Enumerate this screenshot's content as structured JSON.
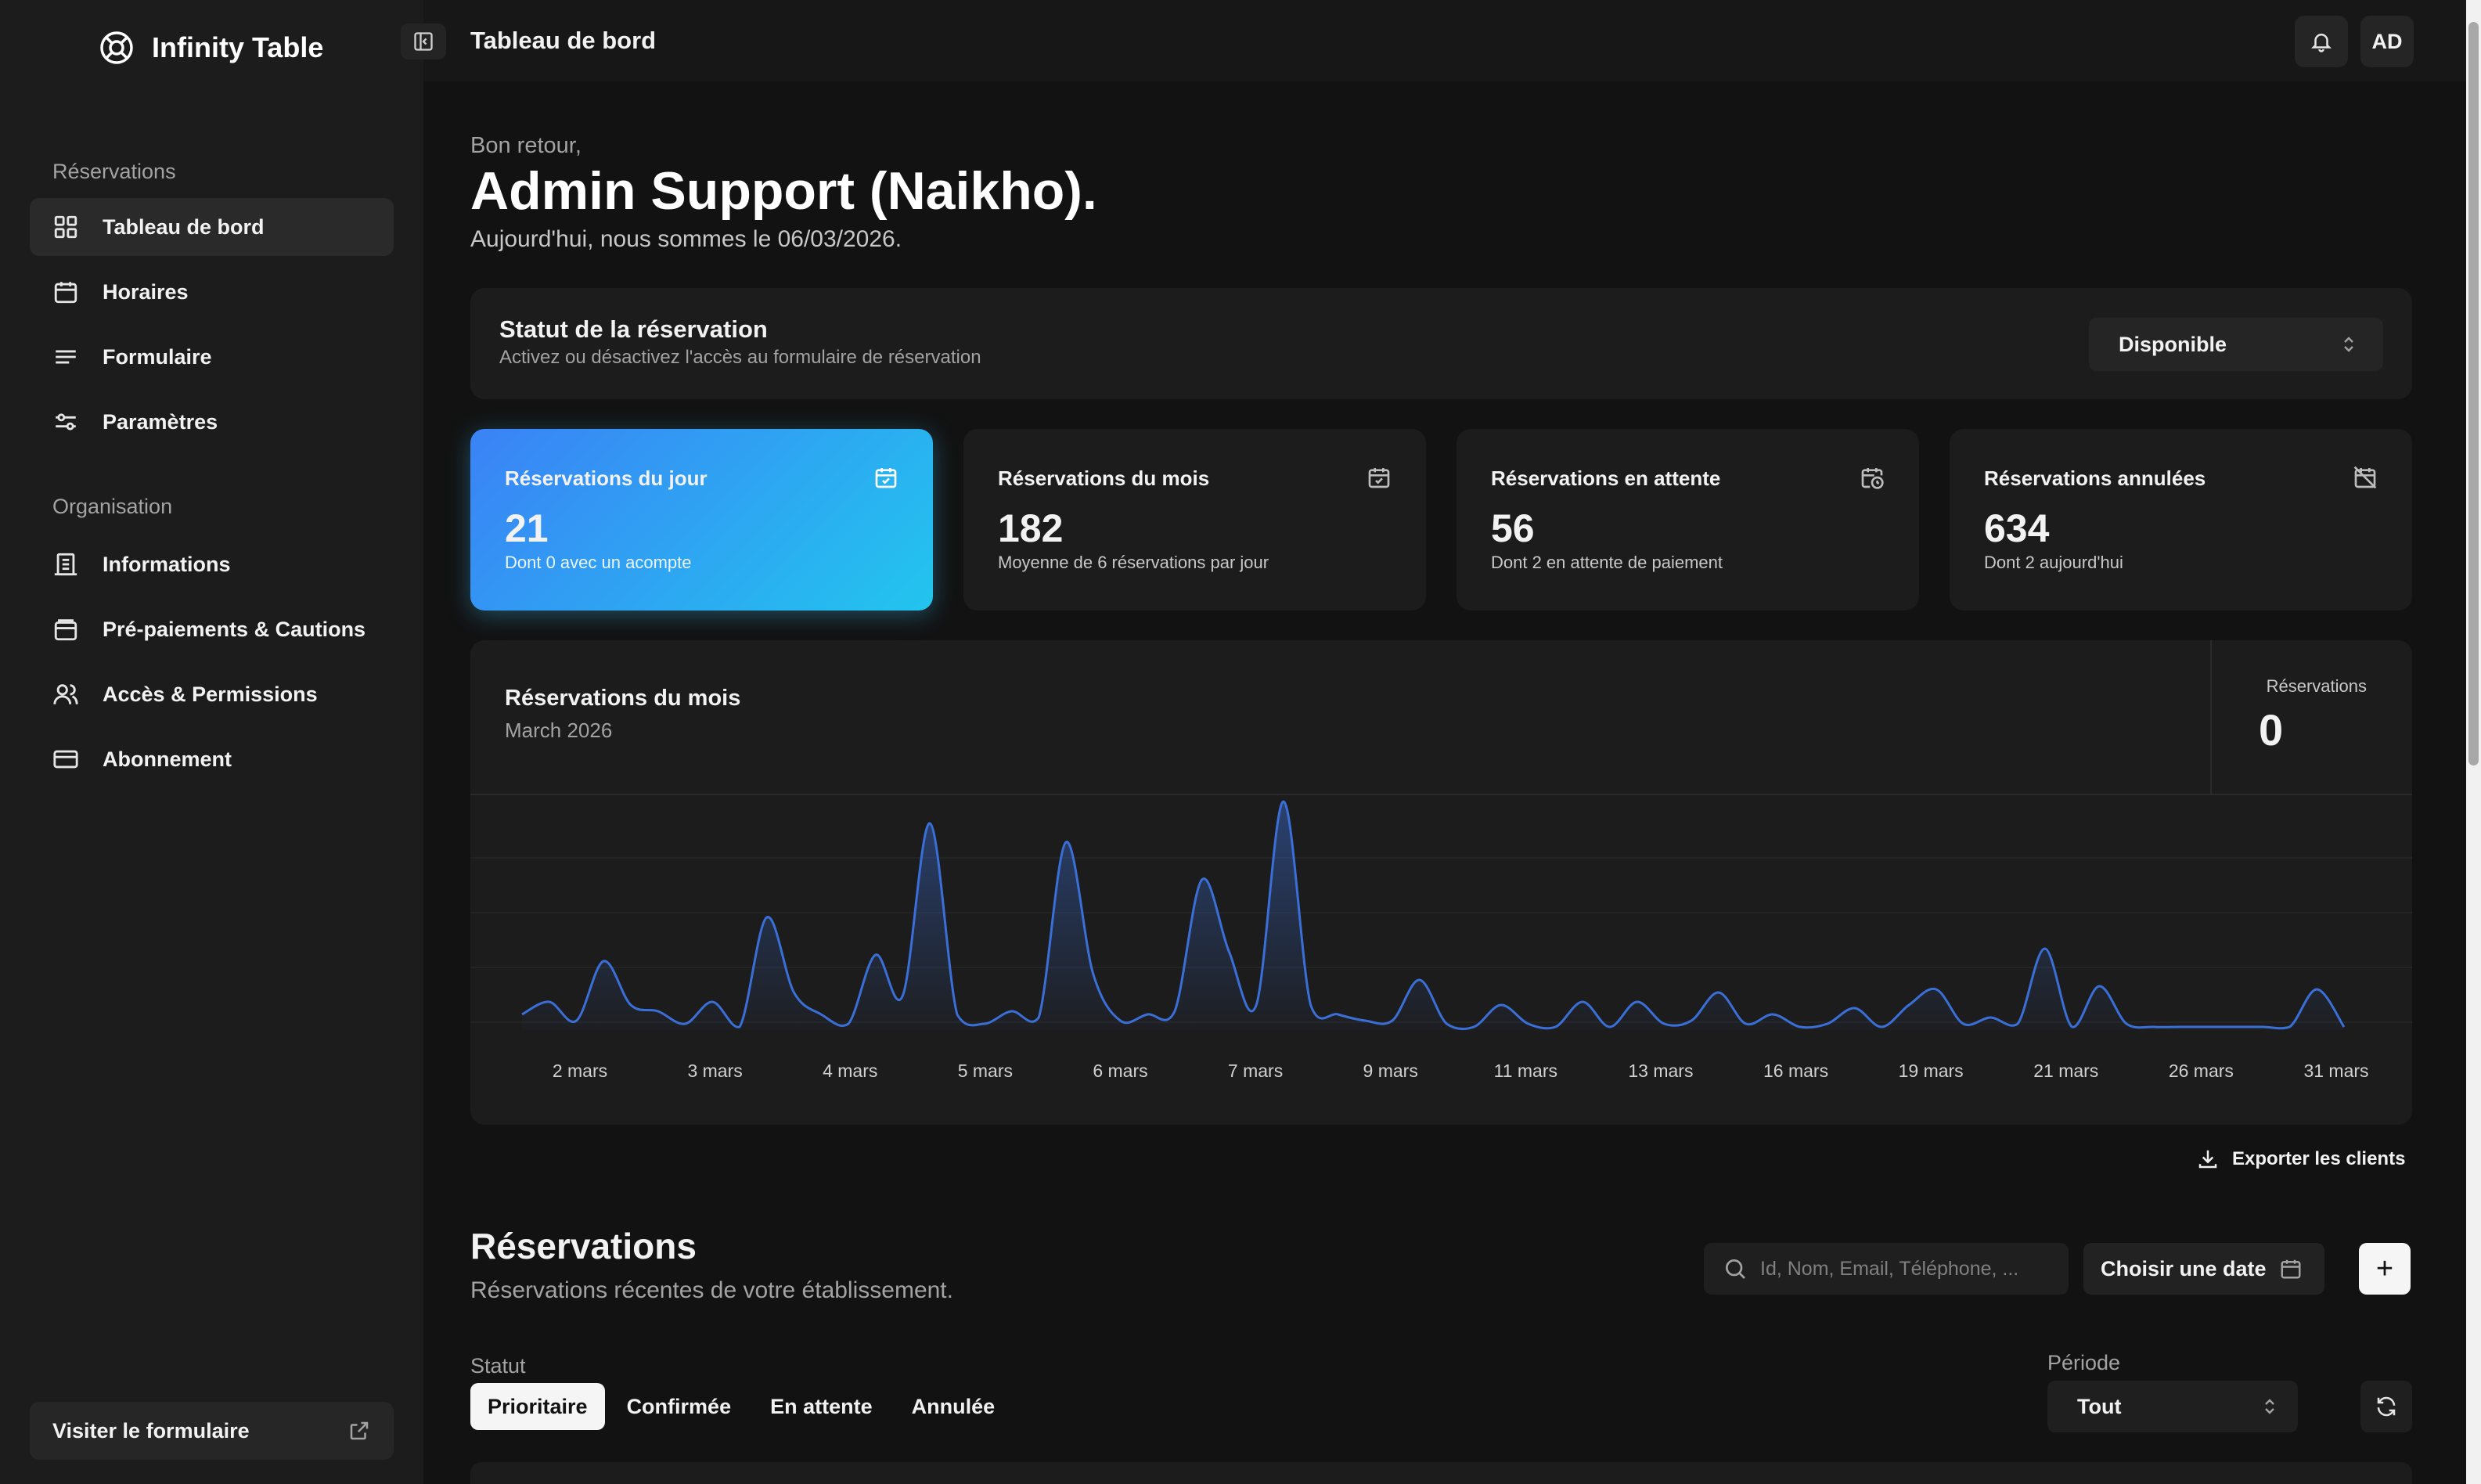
{
  "brand": {
    "name": "Infinity Table"
  },
  "sidebar": {
    "groups": [
      {
        "label": "Réservations",
        "items": [
          {
            "label": "Tableau de bord",
            "icon": "grid-icon"
          },
          {
            "label": "Horaires",
            "icon": "calendar-icon"
          },
          {
            "label": "Formulaire",
            "icon": "text-lines-icon"
          },
          {
            "label": "Paramètres",
            "icon": "sliders-icon"
          }
        ]
      },
      {
        "label": "Organisation",
        "items": [
          {
            "label": "Informations",
            "icon": "building-icon"
          },
          {
            "label": "Pré-paiements & Cautions",
            "icon": "wallet-icon"
          },
          {
            "label": "Accès & Permissions",
            "icon": "users-icon"
          },
          {
            "label": "Abonnement",
            "icon": "credit-card-icon"
          }
        ]
      }
    ],
    "visit_label": "Visiter le formulaire"
  },
  "topbar": {
    "title": "Tableau de bord",
    "avatar": "AD"
  },
  "greeting": {
    "small": "Bon retour,",
    "name": "Admin Support (Naikho).",
    "date": "Aujourd'hui, nous sommes le 06/03/2026."
  },
  "status": {
    "title": "Statut de la réservation",
    "subtitle": "Activez ou désactivez l'accès au formulaire de réservation",
    "value": "Disponible"
  },
  "stats": [
    {
      "label": "Réservations du jour",
      "value": "21",
      "sub": "Dont 0 avec un acompte"
    },
    {
      "label": "Réservations du mois",
      "value": "182",
      "sub": "Moyenne de 6 réservations par jour"
    },
    {
      "label": "Réservations en attente",
      "value": "56",
      "sub": "Dont 2 en attente de paiement"
    },
    {
      "label": "Réservations annulées",
      "value": "634",
      "sub": "Dont 2 aujourd'hui"
    }
  ],
  "chart": {
    "title": "Réservations du mois",
    "subtitle": "March 2026",
    "side_label": "Réservations",
    "side_value": "0"
  },
  "chart_data": {
    "type": "area",
    "title": "Réservations du mois",
    "subtitle": "March 2026",
    "x_ticks": [
      "2 mars",
      "3 mars",
      "4 mars",
      "5 mars",
      "6 mars",
      "7 mars",
      "9 mars",
      "11 mars",
      "13 mars",
      "16 mars",
      "19 mars",
      "21 mars",
      "26 mars",
      "31 mars"
    ],
    "series": [
      {
        "values": [
          0.5,
          0.9,
          0.3,
          2.2,
          0.8,
          0.6,
          0.2,
          0.9,
          0.1,
          3.6,
          1.2,
          0.5,
          0.2,
          2.4,
          1.1,
          6.6,
          0.5,
          0.2,
          0.6,
          0.4,
          6.0,
          1.8,
          0.3,
          0.5,
          0.6,
          4.8,
          2.5,
          0.8,
          7.3,
          0.8,
          0.5,
          0.3,
          0.3,
          1.6,
          0.2,
          0.1,
          0.8,
          0.2,
          0.1,
          0.9,
          0.1,
          0.9,
          0.2,
          0.3,
          1.2,
          0.2,
          0.5,
          0.1,
          0.2,
          0.7,
          0.1,
          0.8,
          1.3,
          0.2,
          0.4,
          0.2,
          2.6,
          0.1,
          1.4,
          0.2,
          0.1,
          0.1,
          0.1,
          0.1,
          0.1,
          0.1,
          1.3,
          0.1
        ]
      }
    ],
    "ylim": [
      0,
      7.5
    ],
    "grid": true,
    "color": "#3b6fd8"
  },
  "actions": {
    "export": "Exporter les clients"
  },
  "reservations": {
    "title": "Réservations",
    "subtitle": "Réservations récentes de votre établissement.",
    "search_placeholder": "Id, Nom, Email, Téléphone, ...",
    "date_label": "Choisir une date",
    "add_label": "+",
    "statut_label": "Statut",
    "filters": [
      "Prioritaire",
      "Confirmée",
      "En attente",
      "Annulée"
    ],
    "periode_label": "Période",
    "periode_value": "Tout"
  },
  "colors": {
    "accent_start": "#3b82f6",
    "accent_end": "#22c5ee",
    "background": "#121212",
    "panel": "#1c1c1c"
  }
}
